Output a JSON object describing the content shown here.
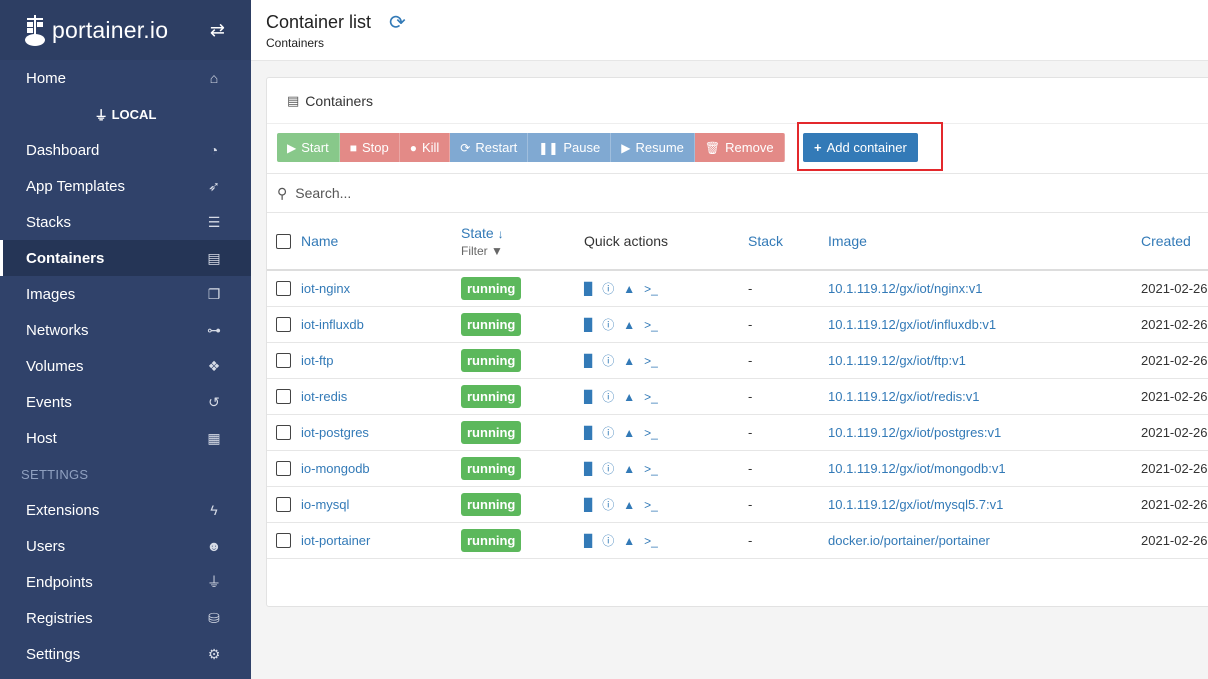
{
  "brand": {
    "name": "portainer.io"
  },
  "sidebar": {
    "home": "Home",
    "endpoint": "LOCAL",
    "items": [
      {
        "label": "Dashboard",
        "icon": "dashboard-icon"
      },
      {
        "label": "App Templates",
        "icon": "rocket-icon"
      },
      {
        "label": "Stacks",
        "icon": "list-icon"
      },
      {
        "label": "Containers",
        "icon": "server-icon"
      },
      {
        "label": "Images",
        "icon": "clone-icon"
      },
      {
        "label": "Networks",
        "icon": "sitemap-icon"
      },
      {
        "label": "Volumes",
        "icon": "cubes-icon"
      },
      {
        "label": "Events",
        "icon": "history-icon"
      },
      {
        "label": "Host",
        "icon": "th-icon"
      }
    ],
    "settings_title": "SETTINGS",
    "settings_items": [
      {
        "label": "Extensions",
        "icon": "bolt-icon"
      },
      {
        "label": "Users",
        "icon": "users-icon"
      },
      {
        "label": "Endpoints",
        "icon": "plug-icon"
      },
      {
        "label": "Registries",
        "icon": "database-icon"
      },
      {
        "label": "Settings",
        "icon": "cogs-icon"
      }
    ]
  },
  "header": {
    "title": "Container list",
    "breadcrumb": "Containers"
  },
  "panel": {
    "title": "Containers"
  },
  "toolbar": {
    "start": "Start",
    "stop": "Stop",
    "kill": "Kill",
    "restart": "Restart",
    "pause": "Pause",
    "resume": "Resume",
    "remove": "Remove",
    "add": "Add container"
  },
  "search": {
    "placeholder": "Search..."
  },
  "table": {
    "columns": {
      "name": "Name",
      "state": "State",
      "filter": "Filter",
      "quick_actions": "Quick actions",
      "stack": "Stack",
      "image": "Image",
      "created": "Created"
    },
    "rows": [
      {
        "name": "iot-nginx",
        "state": "running",
        "stack": "-",
        "image": "10.1.119.12/gx/iot/nginx:v1",
        "created": "2021-02-26"
      },
      {
        "name": "iot-influxdb",
        "state": "running",
        "stack": "-",
        "image": "10.1.119.12/gx/iot/influxdb:v1",
        "created": "2021-02-26"
      },
      {
        "name": "iot-ftp",
        "state": "running",
        "stack": "-",
        "image": "10.1.119.12/gx/iot/ftp:v1",
        "created": "2021-02-26"
      },
      {
        "name": "iot-redis",
        "state": "running",
        "stack": "-",
        "image": "10.1.119.12/gx/iot/redis:v1",
        "created": "2021-02-26"
      },
      {
        "name": "iot-postgres",
        "state": "running",
        "stack": "-",
        "image": "10.1.119.12/gx/iot/postgres:v1",
        "created": "2021-02-26"
      },
      {
        "name": "io-mongodb",
        "state": "running",
        "stack": "-",
        "image": "10.1.119.12/gx/iot/mongodb:v1",
        "created": "2021-02-26"
      },
      {
        "name": "io-mysql",
        "state": "running",
        "stack": "-",
        "image": "10.1.119.12/gx/iot/mysql5.7:v1",
        "created": "2021-02-26"
      },
      {
        "name": "iot-portainer",
        "state": "running",
        "stack": "-",
        "image": "docker.io/portainer/portainer",
        "created": "2021-02-26"
      }
    ]
  },
  "colors": {
    "sidebar": "#30426a",
    "accent": "#337ab7",
    "running": "#5cb85c",
    "highlight": "#e3282c"
  }
}
